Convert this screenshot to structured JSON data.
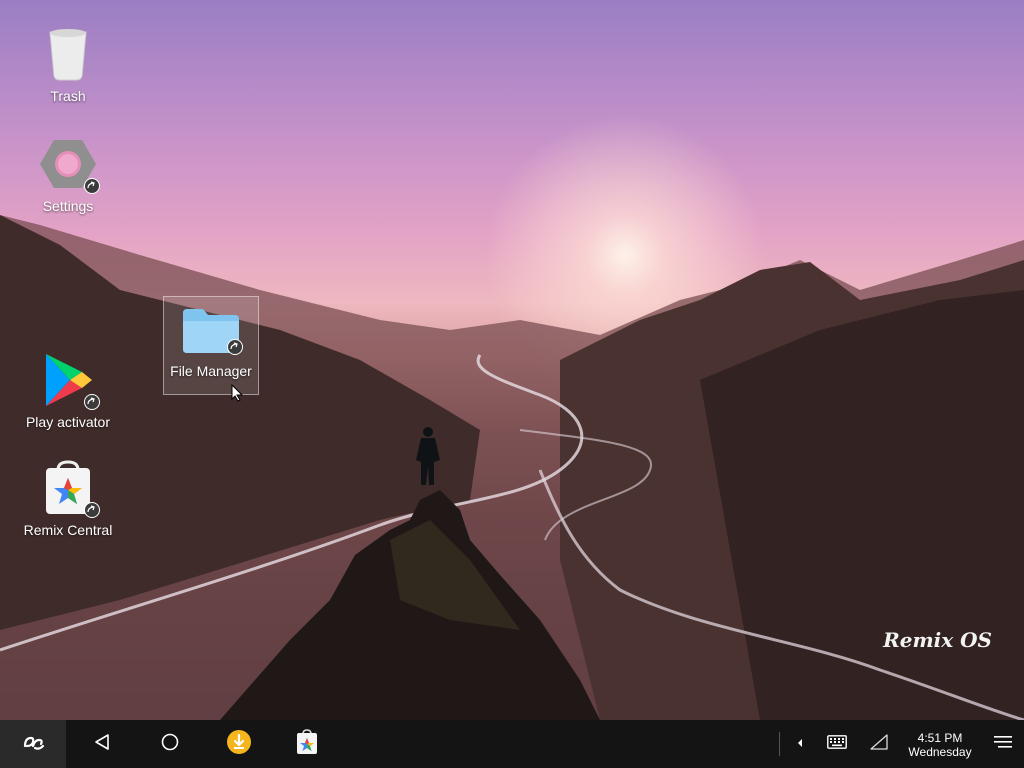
{
  "desktop": {
    "icons": [
      {
        "label": "Trash",
        "icon": "trash-icon"
      },
      {
        "label": "Settings",
        "icon": "settings-icon"
      },
      {
        "label": "File Manager",
        "icon": "folder-icon"
      },
      {
        "label": "Play activator",
        "icon": "play-store-icon"
      },
      {
        "label": "Remix Central",
        "icon": "remix-central-icon"
      }
    ],
    "watermark": "Remix OS"
  },
  "taskbar": {
    "start_icon": "remix-logo-icon",
    "nav": [
      "back-icon",
      "home-icon"
    ],
    "pinned_apps": [
      "download-app-icon",
      "remix-central-app-icon"
    ],
    "tray": [
      "tray-expand-icon",
      "keyboard-icon",
      "signal-icon",
      "notifications-icon"
    ],
    "time": "4:51 PM",
    "day": "Wednesday"
  },
  "colors": {
    "taskbar_bg": "#141414",
    "start_bg": "#2a2a2a",
    "download_accent": "#f5b51d"
  }
}
